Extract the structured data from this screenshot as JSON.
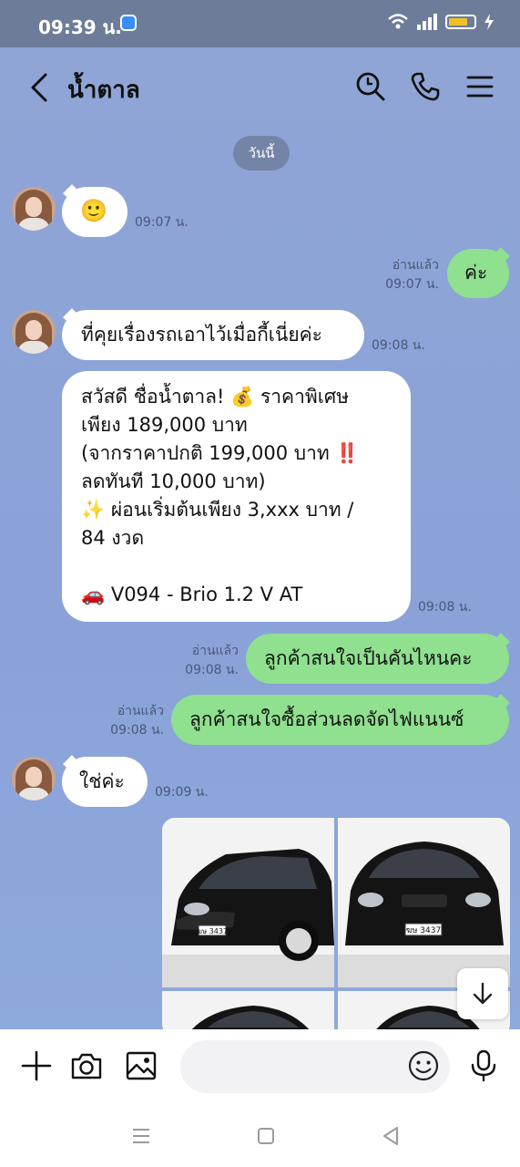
{
  "status_bar": {
    "time": "09:39 น.",
    "battery_level": 0.75
  },
  "header": {
    "title": "น้ำตาล"
  },
  "date_divider": "วันนี้",
  "messages": [
    {
      "side": "in",
      "type": "emoji",
      "text": "🙂",
      "time": "09:07 น."
    },
    {
      "side": "out",
      "text": "ค่ะ",
      "read": "อ่านแล้ว",
      "time": "09:07 น."
    },
    {
      "side": "in",
      "text": "ที่คุยเรื่องรถเอาไว้เมื่อกี้เนี่ยค่ะ",
      "time": "09:08 น."
    },
    {
      "side": "in",
      "text": "สวัสดี ชื่อน้ำตาล! 💰 ราคาพิเศษ\nเพียง 189,000 บาท\n(จากราคาปกติ 199,000 บาท ‼️\nลดทันที 10,000 บาท)\n✨ ผ่อนเริ่มต้นเพียง 3,xxx บาท /\n84 งวด\n\n🚗 V094 - Brio 1.2 V AT",
      "time": "09:08 น."
    },
    {
      "side": "out",
      "text": "ลูกค้าสนใจเป็นคันไหนคะ",
      "read": "อ่านแล้ว",
      "time": "09:08 น."
    },
    {
      "side": "out",
      "text": "ลูกค้าสนใจซื้อส่วนลดจัดไฟแนนซ์",
      "read": "อ่านแล้ว",
      "time": "09:08 น."
    },
    {
      "side": "in",
      "text": "ใช่ค่ะ",
      "time": "09:09 น."
    }
  ],
  "photos": [
    {
      "plate": "ฆษ 3437",
      "view": "front-three-quarter"
    },
    {
      "plate": "ฆษ 3437",
      "view": "front"
    },
    {
      "plate": "",
      "view": "front-partial"
    },
    {
      "plate": "",
      "view": "front-partial"
    }
  ],
  "composer": {
    "placeholder": ""
  },
  "colors": {
    "chat_bg": "#8fa5d6",
    "outgoing_bubble": "#8fe08f",
    "incoming_bubble": "#ffffff",
    "status_bar": "#6d7d99"
  }
}
